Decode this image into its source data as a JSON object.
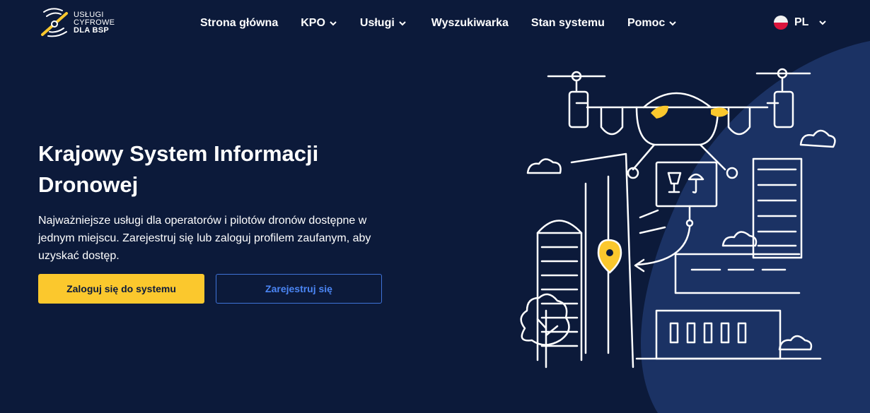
{
  "logo": {
    "line1": "USŁUGI",
    "line2": "CYFROWE",
    "line3": "DLA BSP",
    "icon": "drone-propeller-logo-icon"
  },
  "nav": {
    "items": [
      {
        "label": "Strona główna",
        "has_dropdown": false
      },
      {
        "label": "KPO",
        "has_dropdown": true
      },
      {
        "label": "Usługi",
        "has_dropdown": true
      },
      {
        "label": "Wyszukiwarka",
        "has_dropdown": false
      },
      {
        "label": "Stan systemu",
        "has_dropdown": false
      },
      {
        "label": "Pomoc",
        "has_dropdown": true
      }
    ],
    "language": {
      "label": "PL",
      "flag": "poland-flag-icon"
    }
  },
  "hero": {
    "title": "Krajowy System Informacji Dronowej",
    "description": "Najważniejsze usługi dla operatorów i pilotów dronów dostępne w jednym miejscu. Zarejestruj się lub zaloguj profilem zaufanym, aby uzyskać dostęp.",
    "login_button": "Zaloguj się do systemu",
    "register_button": "Zarejestruj się"
  },
  "colors": {
    "background": "#0c1a3a",
    "curve": "#1b3264",
    "accent": "#fbc82d",
    "link": "#4b86f5"
  },
  "illustration": "drone-city-illustration"
}
